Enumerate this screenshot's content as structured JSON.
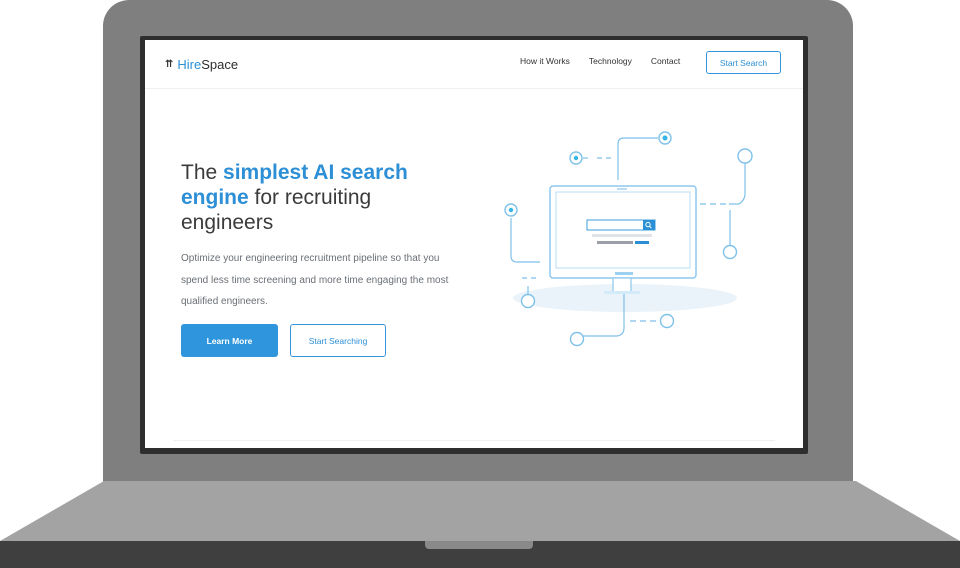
{
  "brand": {
    "name_hire": "Hire",
    "name_space": "Space",
    "mark": "⇈"
  },
  "nav": {
    "links": [
      "How it Works",
      "Technology",
      "Contact"
    ],
    "cta": "Start Search"
  },
  "hero": {
    "title_pre": "The ",
    "title_accent": "simplest AI search engine",
    "title_post": " for recruiting engineers",
    "description": "Optimize your engineering recruitment pipeline so that you spend less time screening and more time engaging the most qualified engineers.",
    "primary_button": "Learn More",
    "secondary_button": "Start Searching"
  },
  "colors": {
    "accent": "#2d8fd5",
    "laptop_frame": "#7f7f7f",
    "text": "#3b3b3b"
  }
}
